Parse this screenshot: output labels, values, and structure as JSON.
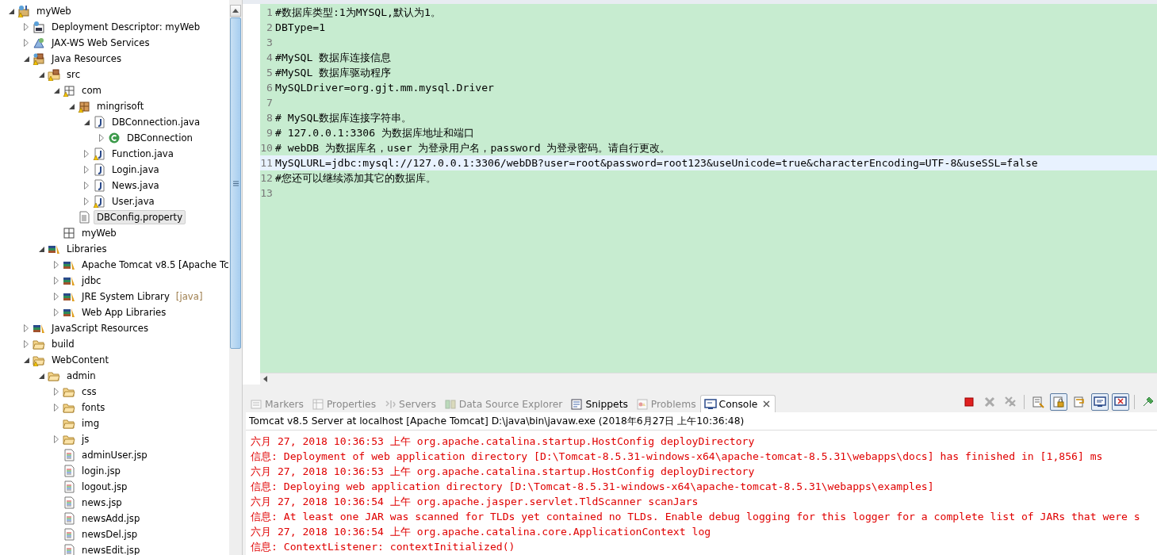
{
  "project_tree": [
    {
      "label": "myWeb",
      "kind": "project",
      "warning": true,
      "expanded": true,
      "selected": false,
      "children": [
        {
          "label": "Deployment Descriptor: myWeb",
          "kind": "descriptor",
          "expanded": false,
          "selected": false
        },
        {
          "label": "JAX-WS Web Services",
          "kind": "webservices",
          "expanded": false,
          "selected": false
        },
        {
          "label": "Java Resources",
          "kind": "javares",
          "warning": true,
          "expanded": true,
          "selected": false,
          "children": [
            {
              "label": "src",
              "kind": "srcfolder",
              "warning": true,
              "expanded": true,
              "selected": false,
              "children": [
                {
                  "label": "com",
                  "kind": "emptypackage",
                  "warning": true,
                  "expanded": true,
                  "selected": false,
                  "children": [
                    {
                      "label": "mingrisoft",
                      "kind": "package",
                      "warning": true,
                      "expanded": true,
                      "selected": false,
                      "children": [
                        {
                          "label": "DBConnection.java",
                          "kind": "javafile",
                          "expanded": true,
                          "selected": false,
                          "children": [
                            {
                              "label": "DBConnection",
                              "kind": "class",
                              "expanded": false,
                              "selected": false
                            }
                          ]
                        },
                        {
                          "label": "Function.java",
                          "kind": "javafile",
                          "warning": true,
                          "expanded": false,
                          "selected": false
                        },
                        {
                          "label": "Login.java",
                          "kind": "javafile",
                          "expanded": false,
                          "selected": false
                        },
                        {
                          "label": "News.java",
                          "kind": "javafile",
                          "expanded": false,
                          "selected": false
                        },
                        {
                          "label": "User.java",
                          "kind": "javafile",
                          "warning": true,
                          "expanded": false,
                          "selected": false
                        }
                      ]
                    },
                    {
                      "label": "DBConfig.property",
                      "kind": "textfile",
                      "selected": true
                    }
                  ]
                },
                {
                  "label": "myWeb",
                  "kind": "module",
                  "selected": false
                }
              ]
            },
            {
              "label": "Libraries",
              "kind": "library",
              "expanded": true,
              "selected": false,
              "children": [
                {
                  "label": "Apache Tomcat v8.5 [Apache Tc",
                  "kind": "library",
                  "expanded": false,
                  "selected": false
                },
                {
                  "label": "jdbc",
                  "kind": "library",
                  "expanded": false,
                  "selected": false
                },
                {
                  "label": "JRE System Library",
                  "decoration": "[java]",
                  "kind": "library",
                  "expanded": false,
                  "selected": false
                },
                {
                  "label": "Web App Libraries",
                  "kind": "library",
                  "expanded": false,
                  "selected": false
                }
              ]
            }
          ]
        },
        {
          "label": "JavaScript Resources",
          "kind": "library",
          "expanded": false,
          "selected": false
        },
        {
          "label": "build",
          "kind": "folder",
          "expanded": false,
          "selected": false
        },
        {
          "label": "WebContent",
          "kind": "folder",
          "warning": true,
          "expanded": true,
          "selected": false,
          "children": [
            {
              "label": "admin",
              "kind": "folder",
              "expanded": true,
              "selected": false,
              "children": [
                {
                  "label": "css",
                  "kind": "folder",
                  "expanded": false,
                  "selected": false
                },
                {
                  "label": "fonts",
                  "kind": "folder",
                  "expanded": false,
                  "selected": false
                },
                {
                  "label": "img",
                  "kind": "folder",
                  "selected": false
                },
                {
                  "label": "js",
                  "kind": "folder",
                  "expanded": false,
                  "selected": false
                },
                {
                  "label": "adminUser.jsp",
                  "kind": "jspfile",
                  "selected": false
                },
                {
                  "label": "login.jsp",
                  "kind": "jspfile",
                  "selected": false
                },
                {
                  "label": "logout.jsp",
                  "kind": "jspfile",
                  "selected": false
                },
                {
                  "label": "news.jsp",
                  "kind": "jspfile",
                  "selected": false
                },
                {
                  "label": "newsAdd.jsp",
                  "kind": "jspfile",
                  "selected": false
                },
                {
                  "label": "newsDel.jsp",
                  "kind": "jspfile",
                  "selected": false
                },
                {
                  "label": "newsEdit.jsp",
                  "kind": "jspfile",
                  "selected": false
                }
              ]
            }
          ]
        }
      ]
    }
  ],
  "editor": {
    "lines": [
      {
        "number": "1",
        "text": "#数据库类型:1为MYSQL,默认为1。",
        "current": false
      },
      {
        "number": "2",
        "text": "DBType=1",
        "current": false
      },
      {
        "number": "3",
        "current": false
      },
      {
        "number": "4",
        "text": "#MySQL 数据库连接信息",
        "current": false
      },
      {
        "number": "5",
        "text": "#MySQL 数据库驱动程序",
        "current": false
      },
      {
        "number": "6",
        "text": "MySQLDriver=org.gjt.mm.mysql.Driver",
        "current": false
      },
      {
        "number": "7",
        "current": false
      },
      {
        "number": "8",
        "text": "# MySQL数据库连接字符串。",
        "current": false
      },
      {
        "number": "9",
        "text": "# 127.0.0.1:3306 为数据库地址和端口",
        "current": false
      },
      {
        "number": "10",
        "text": "# webDB 为数据库名，user 为登录用户名，password 为登录密码。请自行更改。",
        "current": false
      },
      {
        "number": "11",
        "text": "MySQLURL=jdbc:mysql://127.0.0.1:3306/webDB?user=root&password=root123&useUnicode=true&characterEncoding=UTF-8&useSSL=false",
        "current": true
      },
      {
        "number": "12",
        "text": "#您还可以继续添加其它的数据库。",
        "current": false
      },
      {
        "number": "13",
        "current": false
      }
    ]
  },
  "bottom_panel": {
    "tabs": [
      {
        "label": "Markers",
        "kind": "markers",
        "dimmed": true,
        "selected": false
      },
      {
        "label": "Properties",
        "kind": "properties",
        "dimmed": true,
        "selected": false
      },
      {
        "label": "Servers",
        "kind": "servers",
        "dimmed": true,
        "selected": false
      },
      {
        "label": "Data Source Explorer",
        "kind": "datasource",
        "dimmed": true,
        "selected": false
      },
      {
        "label": "Snippets",
        "kind": "snippets",
        "dimmed": false,
        "selected": false
      },
      {
        "label": "Problems",
        "kind": "problems",
        "dimmed": true,
        "selected": false
      },
      {
        "label": "Console",
        "kind": "console",
        "dimmed": false,
        "selected": true,
        "closable": true
      }
    ],
    "toolbar": [
      {
        "kind": "terminate",
        "pressed": false
      },
      {
        "kind": "remove",
        "pressed": false
      },
      {
        "kind": "remove-all",
        "pressed": false
      },
      {
        "kind": "clear",
        "pressed": false
      },
      {
        "kind": "scroll-lock",
        "pressed": true
      },
      {
        "kind": "word-wrap",
        "pressed": false
      },
      {
        "kind": "stdout",
        "pressed": true
      },
      {
        "kind": "stderr",
        "pressed": true
      },
      {
        "kind": "pin",
        "pressed": false
      }
    ],
    "console_title": "Tomcat v8.5 Server at localhost [Apache Tomcat] D:\\java\\bin\\javaw.exe (2018年6月27日 上午10:36:48)",
    "console_lines": [
      "六月 27, 2018 10:36:53 上午 org.apache.catalina.startup.HostConfig deployDirectory",
      "信息: Deployment of web application directory [D:\\Tomcat-8.5.31-windows-x64\\apache-tomcat-8.5.31\\webapps\\docs] has finished in [1,856] ms",
      "六月 27, 2018 10:36:53 上午 org.apache.catalina.startup.HostConfig deployDirectory",
      "信息: Deploying web application directory [D:\\Tomcat-8.5.31-windows-x64\\apache-tomcat-8.5.31\\webapps\\examples]",
      "六月 27, 2018 10:36:54 上午 org.apache.jasper.servlet.TldScanner scanJars",
      "信息: At least one JAR was scanned for TLDs yet contained no TLDs. Enable debug logging for this logger for a complete list of JARs that were s",
      "六月 27, 2018 10:36:54 上午 org.apache.catalina.core.ApplicationContext log",
      "信息: ContextListener: contextInitialized()"
    ]
  }
}
